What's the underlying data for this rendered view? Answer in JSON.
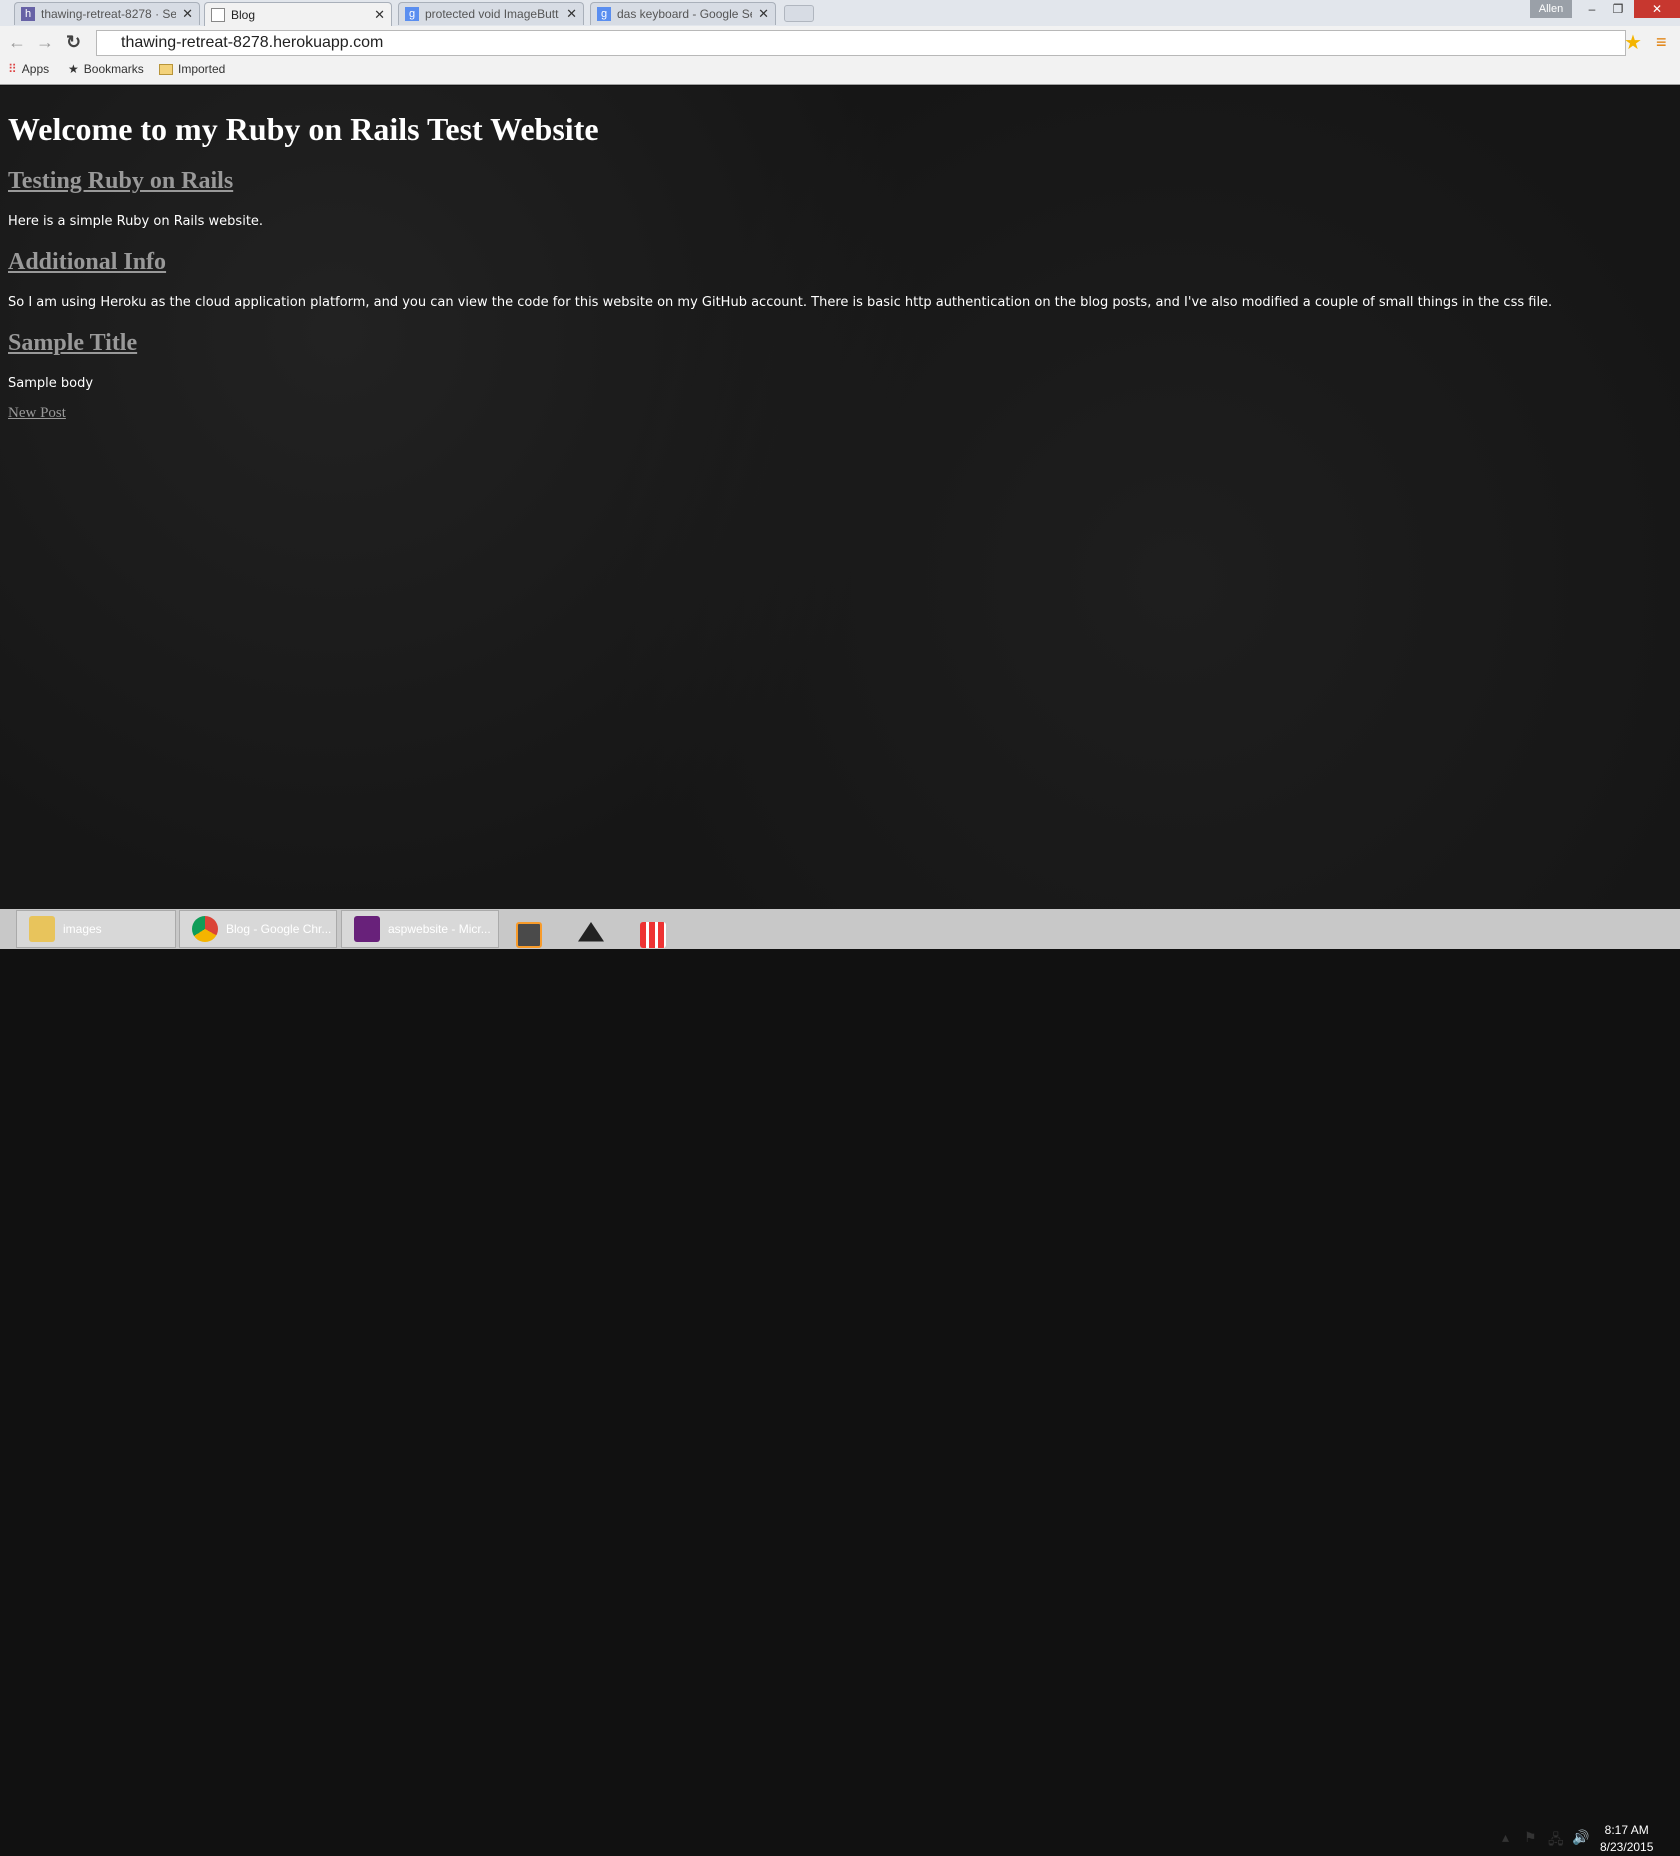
{
  "browser": {
    "tabs": [
      {
        "title": "thawing-retreat-8278 · Se",
        "icon": "heroku-icon",
        "active": false
      },
      {
        "title": "Blog",
        "icon": "page-icon",
        "active": true
      },
      {
        "title": "protected void ImageButt",
        "icon": "google-icon",
        "active": false
      },
      {
        "title": "das keyboard - Google Se",
        "icon": "google-icon",
        "active": false
      }
    ],
    "user": "Allen",
    "url": "thawing-retreat-8278.herokuapp.com",
    "bookmarks": [
      {
        "label": "Apps",
        "icon": "apps-grid-icon"
      },
      {
        "label": "Bookmarks",
        "icon": "star-icon"
      },
      {
        "label": "Imported",
        "icon": "folder-icon"
      }
    ]
  },
  "page": {
    "title": "Welcome to my Ruby on Rails Test Website",
    "posts": [
      {
        "title": "Testing Ruby on Rails",
        "body": "Here is a simple Ruby on Rails website."
      },
      {
        "title": "Additional Info",
        "body": "So I am using Heroku as the cloud application platform, and you can view the code for this website on my GitHub account. There is basic http authentication on the blog posts, and I've also modified a couple of small things in the css file."
      },
      {
        "title": "Sample Title",
        "body": "Sample body"
      }
    ],
    "new_post": "New Post"
  },
  "taskbar": {
    "items": [
      {
        "label": "images",
        "icon": "folder-icon"
      },
      {
        "label": "Blog - Google Chr...",
        "icon": "chrome-icon"
      },
      {
        "label": "aspwebsite - Micr...",
        "icon": "visual-studio-icon"
      }
    ],
    "pinned": [
      "sublime-text-icon",
      "unity-icon",
      "apps-icon"
    ],
    "time": "8:17 AM",
    "date": "8/23/2015"
  }
}
